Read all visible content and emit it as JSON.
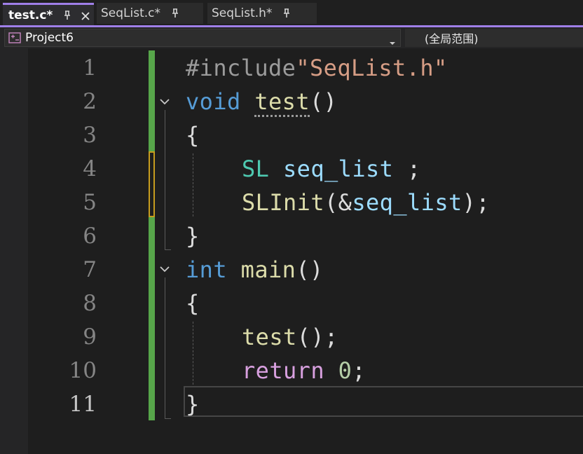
{
  "tabs": [
    {
      "label": "test.c*",
      "active": true
    },
    {
      "label": "SeqList.c*",
      "active": false
    },
    {
      "label": "SeqList.h*",
      "active": false
    }
  ],
  "navbar": {
    "project": "Project6",
    "scope": "(全局范围)"
  },
  "editor": {
    "line_numbers": [
      "1",
      "2",
      "3",
      "4",
      "5",
      "6",
      "7",
      "8",
      "9",
      "10",
      "11"
    ],
    "current_line": 11,
    "lines": {
      "l1": {
        "directive": "#include",
        "header": "\"SeqList.h\""
      },
      "l2": {
        "kw": "void",
        "name": "test",
        "parens": "()"
      },
      "l3": {
        "brace": "{"
      },
      "l4": {
        "type": "SL",
        "var": "seq_list",
        "semi": " ;"
      },
      "l5": {
        "fn": "SLInit",
        "open": "(&",
        "var": "seq_list",
        "close": ");"
      },
      "l6": {
        "brace": "}"
      },
      "l7": {
        "kw": "int",
        "name": "main",
        "parens": "()"
      },
      "l8": {
        "brace": "{"
      },
      "l9": {
        "fn": "test",
        "rest": "();"
      },
      "l10": {
        "kw": "return",
        "num": "0",
        "semi": ";"
      },
      "l11": {
        "brace": "}"
      }
    }
  },
  "colors": {
    "accent": "#9f7fe8",
    "keyword": "#569cd6",
    "type": "#4ec9b0",
    "function": "#dcdcaa",
    "variable": "#9cdcfe",
    "string": "#d69d85",
    "control": "#d8a0df",
    "number": "#b5cea8",
    "saved_change": "#57a64a",
    "unsaved_change": "#c69c1e"
  },
  "icons": [
    "pin-icon",
    "close-icon",
    "project-icon",
    "chevron-down-icon",
    "fold-collapse-icon"
  ]
}
